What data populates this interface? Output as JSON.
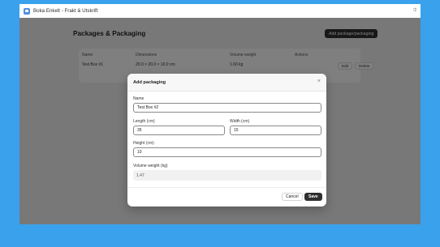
{
  "window": {
    "title": "Boka Enkelt - Frakt & Utskrift"
  },
  "page": {
    "title": "Packages & Packaging",
    "add_button": "Add package/packaging"
  },
  "table": {
    "headers": [
      "Name",
      "Dimensions",
      "Volume weight",
      "Actions"
    ],
    "rows": [
      {
        "name": "Test Box #1",
        "dimensions": "20.0 × 20.0 × 10.0 cm",
        "volume_weight": "1.60 kg",
        "edit": "Edit",
        "delete": "Delete"
      }
    ]
  },
  "modal": {
    "title": "Add packaging",
    "close": "×",
    "name_label": "Name",
    "name_value": "Test Box #2",
    "length_label": "Length (cm)",
    "length_value": "35",
    "width_label": "Width (cm)",
    "width_value": "15",
    "height_label": "Height (cm)",
    "height_value": "10",
    "volume_label": "Volume weight (kg)",
    "volume_value": "1.47",
    "cancel": "Cancel",
    "save": "Save"
  }
}
